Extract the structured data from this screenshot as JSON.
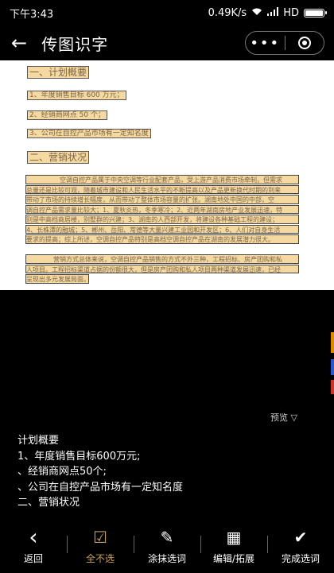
{
  "status": {
    "time": "下午3:43",
    "speed": "0.49K/s",
    "network": "HD"
  },
  "titlebar": {
    "title": "传图识字",
    "back_icon": "back-arrow-icon",
    "more_icon": "more-dots-icon",
    "close_icon": "target-icon"
  },
  "document": {
    "heading1": "一、计划概要",
    "item1": "1、年度销售目标 600 万元；",
    "item2": "2、经销商网点 50 个；",
    "item3": "3、公司在自控产品市场有一定知名度",
    "heading2": "二、营销状况",
    "para1": [
      "空调自控产品属于中央空调等行业配套产品，受上游产品消费市场牵制，但需求",
      "总量还是比较可观，随着城市建设和人民生活水平的不断提高以及产品更新换代时期的到来",
      "带动了市场的持续增长幅度，从而带动了整体市场容量的扩张。湖南地处中国的中部，空",
      "调自控产品需求量比较大；1、夏秋炎热，冬季寒冷；2、近两年湖南房地产业发展迅速，特",
      "别是中高档商居楼，别墅群的兴建；3、湖南的人西部开发，将建设各种基础工程的建设；",
      "4、长株潭的融城；5、郴州、岳阳、常德等大量兴建工业园和开发区；6、人们对自身生活",
      "要求的提高；综上所述，空调自控产品特别是高档空调自控产品在湖南的发展潜力很大。"
    ],
    "para2": [
      "营销方式总体来说，空调自控产品销售的方式不外三种，工程招标、房产团购和私",
      "人项目。工程招标渠道占据的份额很大，但是房产团购和私人项目两种渠道发展迅速，已经",
      "呈现出多元发展局面。"
    ]
  },
  "preview_label": "预览 ▽",
  "result_lines": [
    "计划概要",
    "1、年度销售目标600万元;",
    "、经销商网点50个;",
    "、公司在自控产品市场有一定知名度",
    "二、营销状况"
  ],
  "toolbar": [
    {
      "label": "返回",
      "icon": "back-chevron-icon",
      "glyph": "‹"
    },
    {
      "label": "全不选",
      "icon": "checkbox-icon",
      "glyph": "☑"
    },
    {
      "label": "涂抹选词",
      "icon": "pen-icon",
      "glyph": "✎"
    },
    {
      "label": "编辑/拓展",
      "icon": "grid-edit-icon",
      "glyph": "▦"
    },
    {
      "label": "完成选词",
      "icon": "checkmark-icon",
      "glyph": "✔"
    }
  ],
  "colors": {
    "highlight": "#f5d9a0",
    "accent": "#c9a15e",
    "background": "#000000"
  }
}
